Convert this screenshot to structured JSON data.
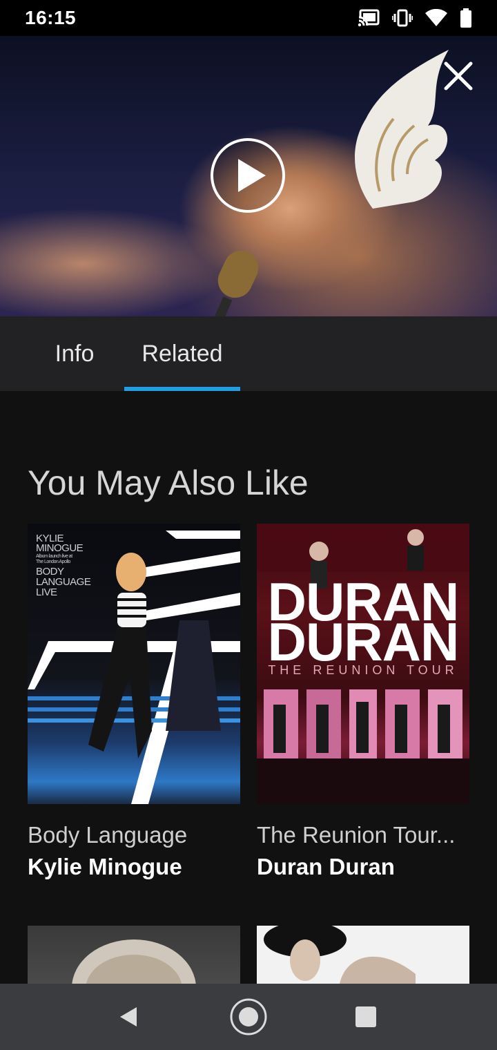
{
  "status_bar": {
    "time": "16:15",
    "icons": [
      "cast-icon",
      "vibrate-icon",
      "wifi-icon",
      "battery-icon"
    ]
  },
  "hero": {
    "play_icon": "play-icon",
    "close_icon": "close-icon"
  },
  "tabs": [
    {
      "label": "Info",
      "selected": false
    },
    {
      "label": "Related",
      "selected": true
    }
  ],
  "colors": {
    "accent": "#1fa0e6",
    "background": "#111112",
    "tab_bar": "#222224",
    "nav_bar": "#3a3c40"
  },
  "section": {
    "title": "You May Also Like"
  },
  "items": [
    {
      "title": "Body Language",
      "artist": "Kylie Minogue",
      "cover_text": [
        "KYLIE",
        "MINOGUE",
        "Album launch live at",
        "The London Apollo",
        "BODY",
        "LANGUAGE",
        "LIVE"
      ]
    },
    {
      "title": "The Reunion Tour...",
      "artist": "Duran Duran",
      "cover_text": [
        "DURAN",
        "DURAN",
        "THE REUNION TOUR"
      ]
    }
  ],
  "nav": {
    "back_icon": "back-icon",
    "home_icon": "home-icon",
    "recents_icon": "recents-icon"
  }
}
